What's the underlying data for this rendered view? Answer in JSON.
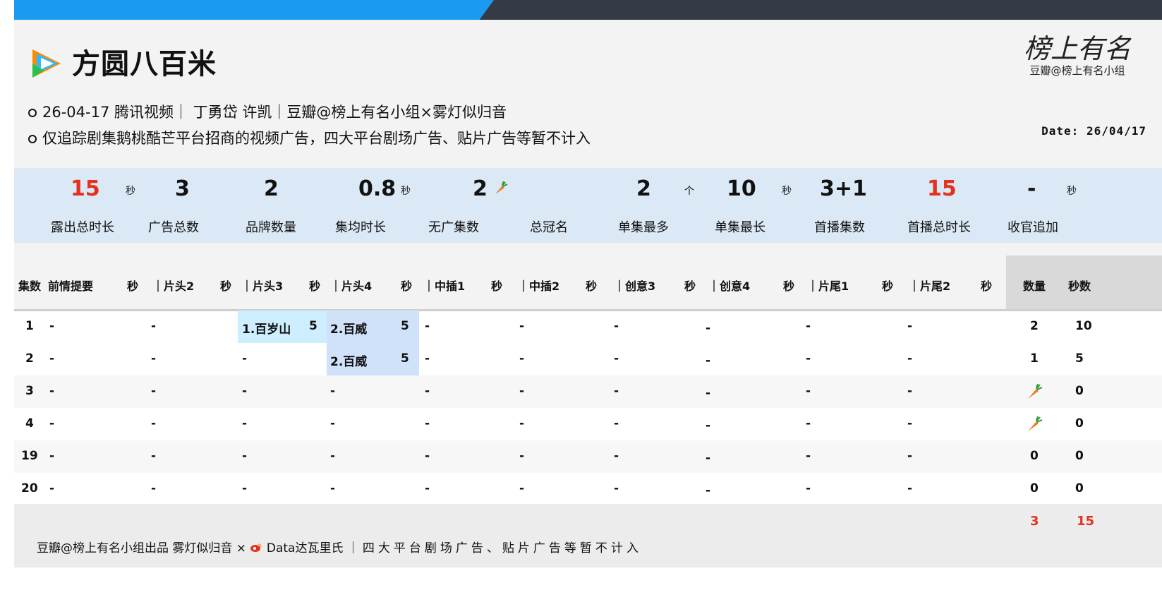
{
  "header": {
    "title": "方圆八百米",
    "brand_script": "榜上有名",
    "brand_sub": "豆瓣@榜上有名小组",
    "meta1": "26-04-17 腾讯视频｜ 丁勇岱 许凯｜豆瓣@榜上有名小组×雾灯似归音",
    "meta2": "仅追踪剧集鹅桃酷芒平台招商的视频广告，四大平台剧场广告、贴片广告等暂不计入",
    "date": "Date: 26/04/17"
  },
  "stats": [
    {
      "value": "15",
      "unit": "秒",
      "label": "露出总时长"
    },
    {
      "value": "3",
      "unit": "",
      "label": "广告总数"
    },
    {
      "value": "2",
      "unit": "",
      "label": "品牌数量"
    },
    {
      "value": "0.8",
      "unit": "秒",
      "label": "集均时长"
    },
    {
      "value": "2",
      "unit": "",
      "label": "无广集数"
    },
    {
      "value": "",
      "unit": "",
      "label": "总冠名"
    },
    {
      "value": "2",
      "unit": "个",
      "label": "单集最多"
    },
    {
      "value": "10",
      "unit": "秒",
      "label": "单集最长"
    },
    {
      "value": "3+1",
      "unit": "",
      "label": "首播集数"
    },
    {
      "value": "15",
      "unit": "",
      "label": "首播总时长"
    },
    {
      "value": "-",
      "unit": "秒",
      "label": "收官追加"
    }
  ],
  "colors": {
    "accent_red": "#e53020",
    "top_blue": "#1a9bf0",
    "top_dark": "#343a46",
    "stats_bg": "#dbe8f5"
  },
  "table": {
    "headers": [
      "集数",
      "前情提要",
      "秒",
      "｜片头2",
      "秒",
      "｜片头3",
      "秒",
      "｜片头4",
      "秒",
      "｜中插1",
      "秒",
      "｜中插2",
      "秒",
      "｜创意3",
      "秒",
      "｜创意4",
      "秒",
      "｜片尾1",
      "秒",
      "｜片尾2",
      "秒",
      "数量",
      "秒数"
    ],
    "rows": [
      {
        "ep": "1",
        "c1": "-",
        "c2": "-",
        "c3": "1.百岁山",
        "c3s": "5",
        "c4": "2.百威",
        "c4s": "5",
        "c5": "-",
        "c6": "-",
        "c7": "-",
        "c8": "-",
        "c9": "-",
        "c10": "-",
        "count": "2",
        "secs": "10"
      },
      {
        "ep": "2",
        "c1": "-",
        "c2": "-",
        "c3": "-",
        "c3s": "",
        "c4": "2.百威",
        "c4s": "5",
        "c5": "-",
        "c6": "-",
        "c7": "-",
        "c8": "-",
        "c9": "-",
        "c10": "-",
        "count": "1",
        "secs": "5"
      },
      {
        "ep": "3",
        "c1": "-",
        "c2": "-",
        "c3": "-",
        "c3s": "",
        "c4": "-",
        "c4s": "",
        "c5": "-",
        "c6": "-",
        "c7": "-",
        "c8": "-",
        "c9": "-",
        "c10": "-",
        "count": "carrot",
        "secs": "0"
      },
      {
        "ep": "4",
        "c1": "-",
        "c2": "-",
        "c3": "-",
        "c3s": "",
        "c4": "-",
        "c4s": "",
        "c5": "-",
        "c6": "-",
        "c7": "-",
        "c8": "-",
        "c9": "-",
        "c10": "-",
        "count": "carrot",
        "secs": "0"
      },
      {
        "ep": "19",
        "c1": "-",
        "c2": "-",
        "c3": "-",
        "c3s": "",
        "c4": "-",
        "c4s": "",
        "c5": "-",
        "c6": "-",
        "c7": "-",
        "c8": "-",
        "c9": "-",
        "c10": "-",
        "count": "0",
        "secs": "0"
      },
      {
        "ep": "20",
        "c1": "-",
        "c2": "-",
        "c3": "-",
        "c3s": "",
        "c4": "-",
        "c4s": "",
        "c5": "-",
        "c6": "-",
        "c7": "-",
        "c8": "-",
        "c9": "-",
        "c10": "-",
        "count": "0",
        "secs": "0"
      }
    ],
    "totals": {
      "count": "3",
      "secs": "15"
    }
  },
  "footer": {
    "left": "豆瓣@榜上有名小组出品 雾灯似归音 ×",
    "weibo": "Data达瓦里氏",
    "right": "｜四大平台剧场广告、贴片广告等暂不计入"
  }
}
